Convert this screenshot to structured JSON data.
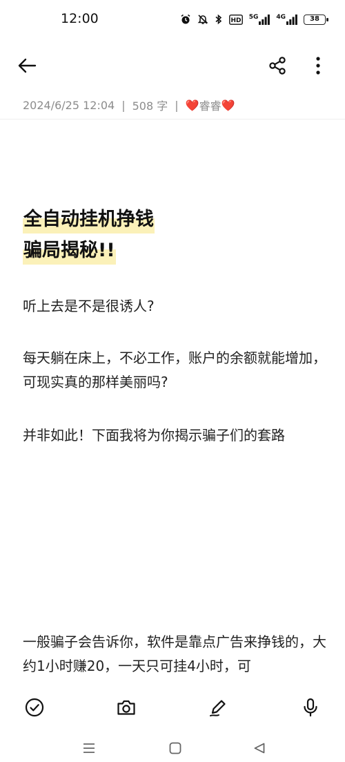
{
  "status_bar": {
    "time": "12:00",
    "net1": "5G",
    "net2": "4G",
    "hd": "HD",
    "battery": "38",
    "icons": [
      "alarm-icon",
      "bell-off-icon",
      "bluetooth-icon",
      "hd-icon",
      "signal-icon",
      "signal-icon",
      "battery-icon"
    ]
  },
  "top_bar": {
    "icons": [
      "back-arrow-icon",
      "share-icon",
      "more-vertical-icon"
    ]
  },
  "meta": {
    "date": "2024/6/25 12:04",
    "separator": "|",
    "word_count": "508 字",
    "author_prefix": "❤️",
    "author": "睿睿",
    "author_suffix": "❤️"
  },
  "note": {
    "heading_line1": "全自动挂机挣钱",
    "heading_line2": "骗局揭秘!!",
    "paragraphs": [
      "听上去是不是很诱人?",
      "每天躺在床上，不必工作，账户的余额就能增加，可现实真的那样美丽吗?",
      "并非如此！下面我将为你揭示骗子们的套路",
      "一般骗子会告诉你，软件是靠点广告来挣钱的，大约1小时赚20，一天只可挂4小时，可"
    ]
  },
  "toolbar": {
    "icons": [
      "check-circle-icon",
      "camera-icon",
      "pen-icon",
      "microphone-icon"
    ]
  },
  "nav": {
    "icons": [
      "menu-icon",
      "home-square-icon",
      "back-triangle-icon"
    ]
  },
  "colors": {
    "highlight": "#fbf1b9",
    "meta_text": "#8c8c8c",
    "heart": "#f08a8a"
  }
}
